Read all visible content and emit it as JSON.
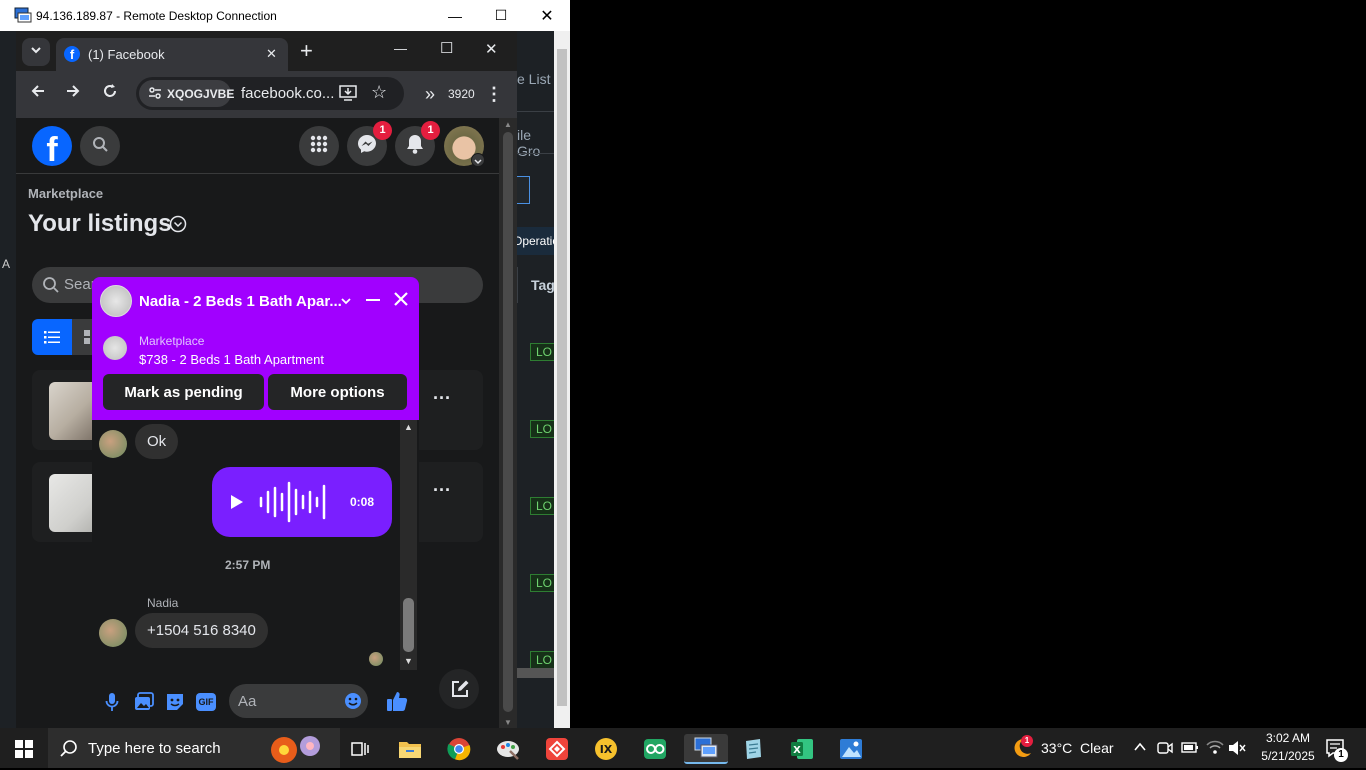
{
  "rdc": {
    "title": "94.136.189.87 - Remote Desktop Connection",
    "minimize": "—",
    "maximize": "☐",
    "close": "✕"
  },
  "remote_bg": {
    "list_label": "e List",
    "group_label": "ile Gro",
    "operation_label": "Operatio",
    "tag_header": "Tag",
    "status_cells": [
      "LO",
      "LO",
      "LO",
      "LO",
      "LO"
    ],
    "left_char": "A"
  },
  "chrome": {
    "tab_title": "(1) Facebook",
    "tab_close": "✕",
    "new_tab": "+",
    "minimize": "—",
    "maximize": "☐",
    "close": "✕",
    "profile_chip": "XQOGJVBE",
    "url": "facebook.co...",
    "counter": "3920",
    "more": "⋮"
  },
  "fb": {
    "messenger_badge": "1",
    "notification_badge": "1",
    "breadcrumb": "Marketplace",
    "page_title": "Your listings",
    "search_placeholder": "Sear",
    "listing_more": "···"
  },
  "chat": {
    "title": "Nadia - 2 Beds 1 Bath Apar...",
    "context_label": "Marketplace",
    "context_item": "$738 - 2 Beds 1 Bath Apartment",
    "mark_pending": "Mark as pending",
    "more_options": "More options",
    "message_ok": "Ok",
    "voice_duration": "0:08",
    "timestamp": "2:57 PM",
    "sender_name": "Nadia",
    "message_phone": "+1504 516 8340",
    "composer_placeholder": "Aa"
  },
  "taskbar": {
    "search_placeholder": "Type here to search",
    "weather": "33°C  Clear",
    "time": "3:02 AM",
    "date": "5/21/2025",
    "notification_count": "1",
    "weather_badge": "1"
  },
  "colors": {
    "chat_header": "#a100ff",
    "voice_bubble": "#7a1fff",
    "fb_blue": "#0866ff",
    "badge_red": "#e41e3f"
  }
}
